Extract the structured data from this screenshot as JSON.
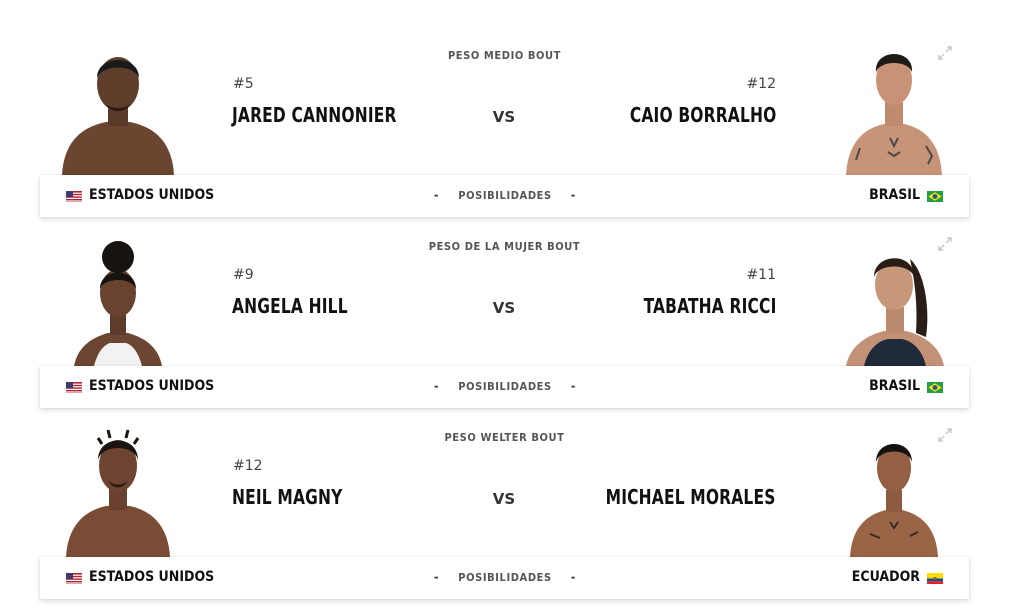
{
  "fights": [
    {
      "bout": "PESO MEDIO BOUT",
      "odds_label": "POSIBILIDADES",
      "red": {
        "rank": "#5",
        "name": "JARED CANNONIER",
        "country": "ESTADOS UNIDOS",
        "flag": "flag-usa"
      },
      "blue": {
        "rank": "#12",
        "name": "CAIO BORRALHO",
        "country": "BRASIL",
        "flag": "flag-brazil"
      }
    },
    {
      "bout": "PESO DE LA MUJER BOUT",
      "odds_label": "POSIBILIDADES",
      "red": {
        "rank": "#9",
        "name": "ANGELA HILL",
        "country": "ESTADOS UNIDOS",
        "flag": "flag-usa"
      },
      "blue": {
        "rank": "#11",
        "name": "TABATHA RICCI",
        "country": "BRASIL",
        "flag": "flag-brazil"
      }
    },
    {
      "bout": "PESO WELTER BOUT",
      "odds_label": "POSIBILIDADES",
      "red": {
        "rank": "#12",
        "name": "NEIL MAGNY",
        "country": "ESTADOS UNIDOS",
        "flag": "flag-usa"
      },
      "blue": {
        "rank": "",
        "name": "MICHAEL MORALES",
        "country": "ECUADOR",
        "flag": "flag-ecuador"
      }
    }
  ],
  "vs_label": "VS",
  "odds_dash": "-",
  "icons": {
    "expand": "expand-arrows-icon"
  },
  "colors": {
    "text": "#111111",
    "muted": "#555555",
    "bar_bg": "#ffffff"
  }
}
